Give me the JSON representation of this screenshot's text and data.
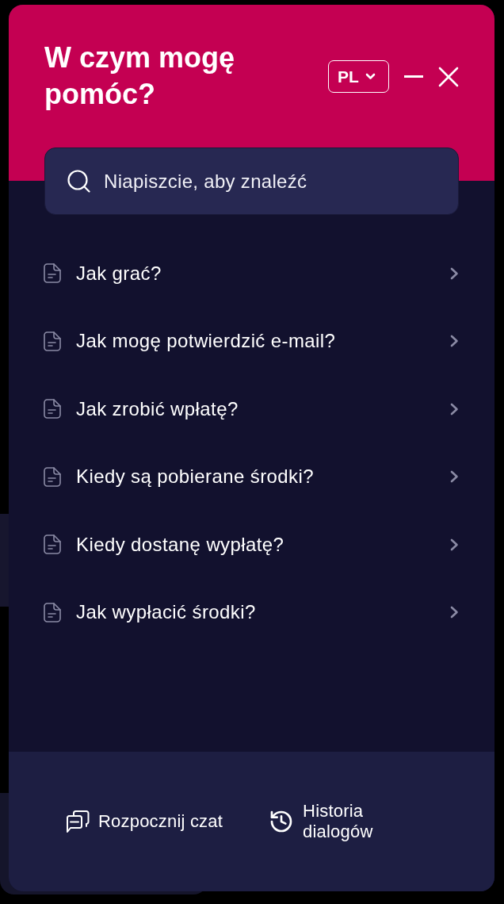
{
  "header": {
    "title": "W czym mogę pomóc?",
    "language": "PL"
  },
  "search": {
    "placeholder": "Niapiszcie, aby znaleźć"
  },
  "articles": [
    {
      "title": "Jak grać?"
    },
    {
      "title": "Jak mogę potwierdzić e-mail?"
    },
    {
      "title": "Jak zrobić wpłatę?"
    },
    {
      "title": "Kiedy są pobierane środki?"
    },
    {
      "title": "Kiedy dostanę wypłatę?"
    },
    {
      "title": "Jak wypłacić środki?"
    }
  ],
  "footer": {
    "actions": [
      {
        "kind": "chat",
        "label": "Rozpocznij czat"
      },
      {
        "kind": "history",
        "label": "Historia dialogów"
      }
    ]
  }
}
